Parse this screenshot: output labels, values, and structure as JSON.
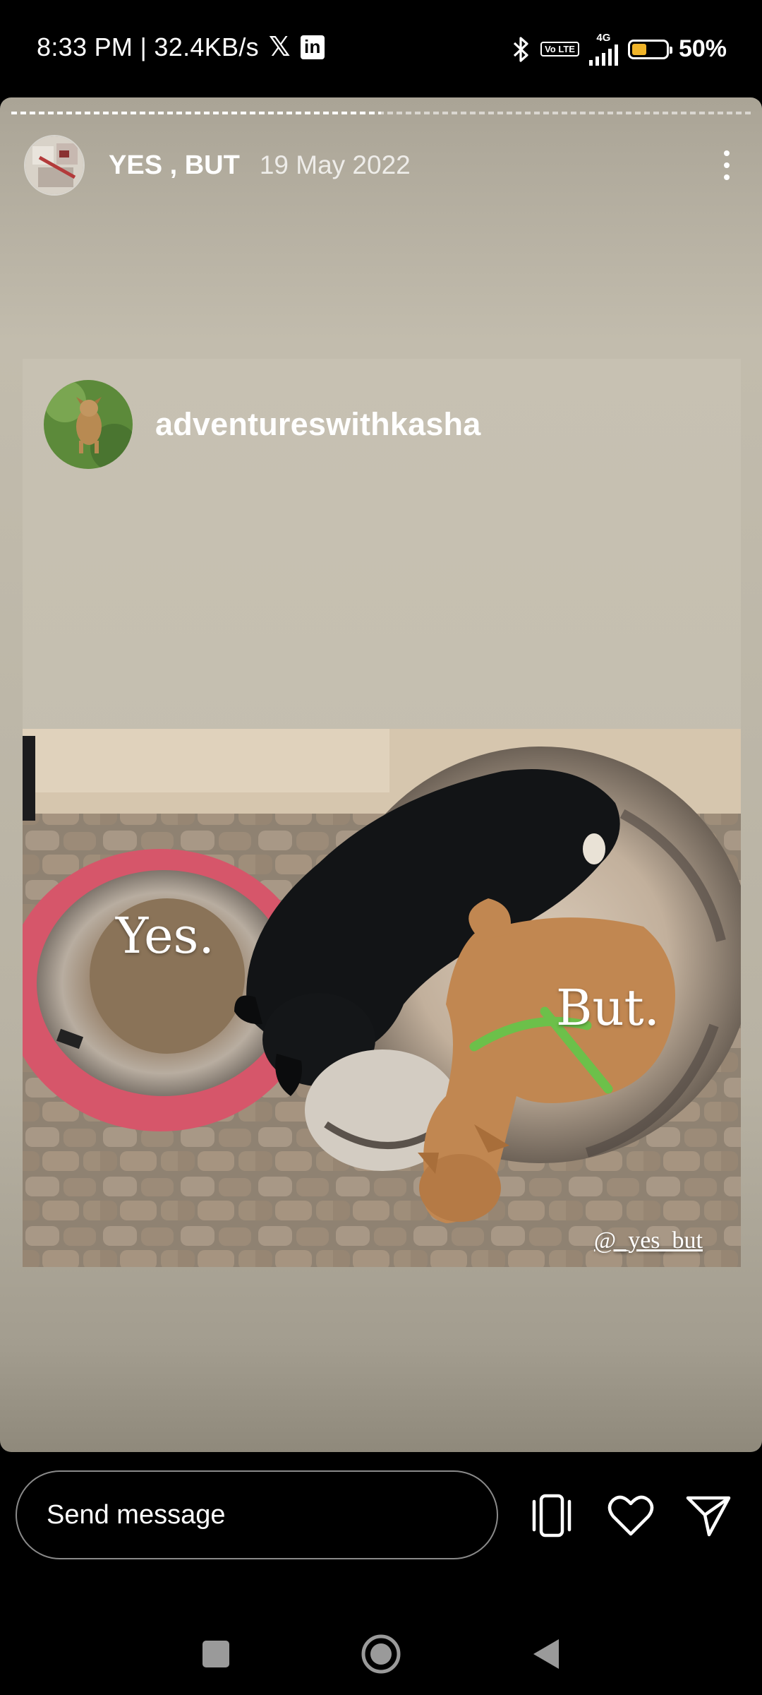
{
  "status_bar": {
    "time_speed": "8:33 PM | 32.4KB/s",
    "x_icon": "x-logo-icon",
    "linkedin_icon": "linkedin-icon",
    "network_type": "4G",
    "volte_label": "Vo LTE",
    "battery_percent": "50%",
    "battery_level": 0.5,
    "battery_color": "#f0b429"
  },
  "story": {
    "username": "YES , BUT",
    "date": "19 May 2022",
    "progress_fraction": 0.5
  },
  "post": {
    "username": "adventureswithkasha",
    "photo_text_left": "Yes.",
    "photo_text_right": "But.",
    "photo_handle": "@_yes_but"
  },
  "bottom_bar": {
    "message_placeholder": "Send message",
    "icons": [
      "phone-rotate-icon",
      "heart-icon",
      "send-icon"
    ]
  },
  "nav_bar": {
    "icons": [
      "recents-square-icon",
      "home-circle-icon",
      "back-triangle-icon"
    ]
  }
}
